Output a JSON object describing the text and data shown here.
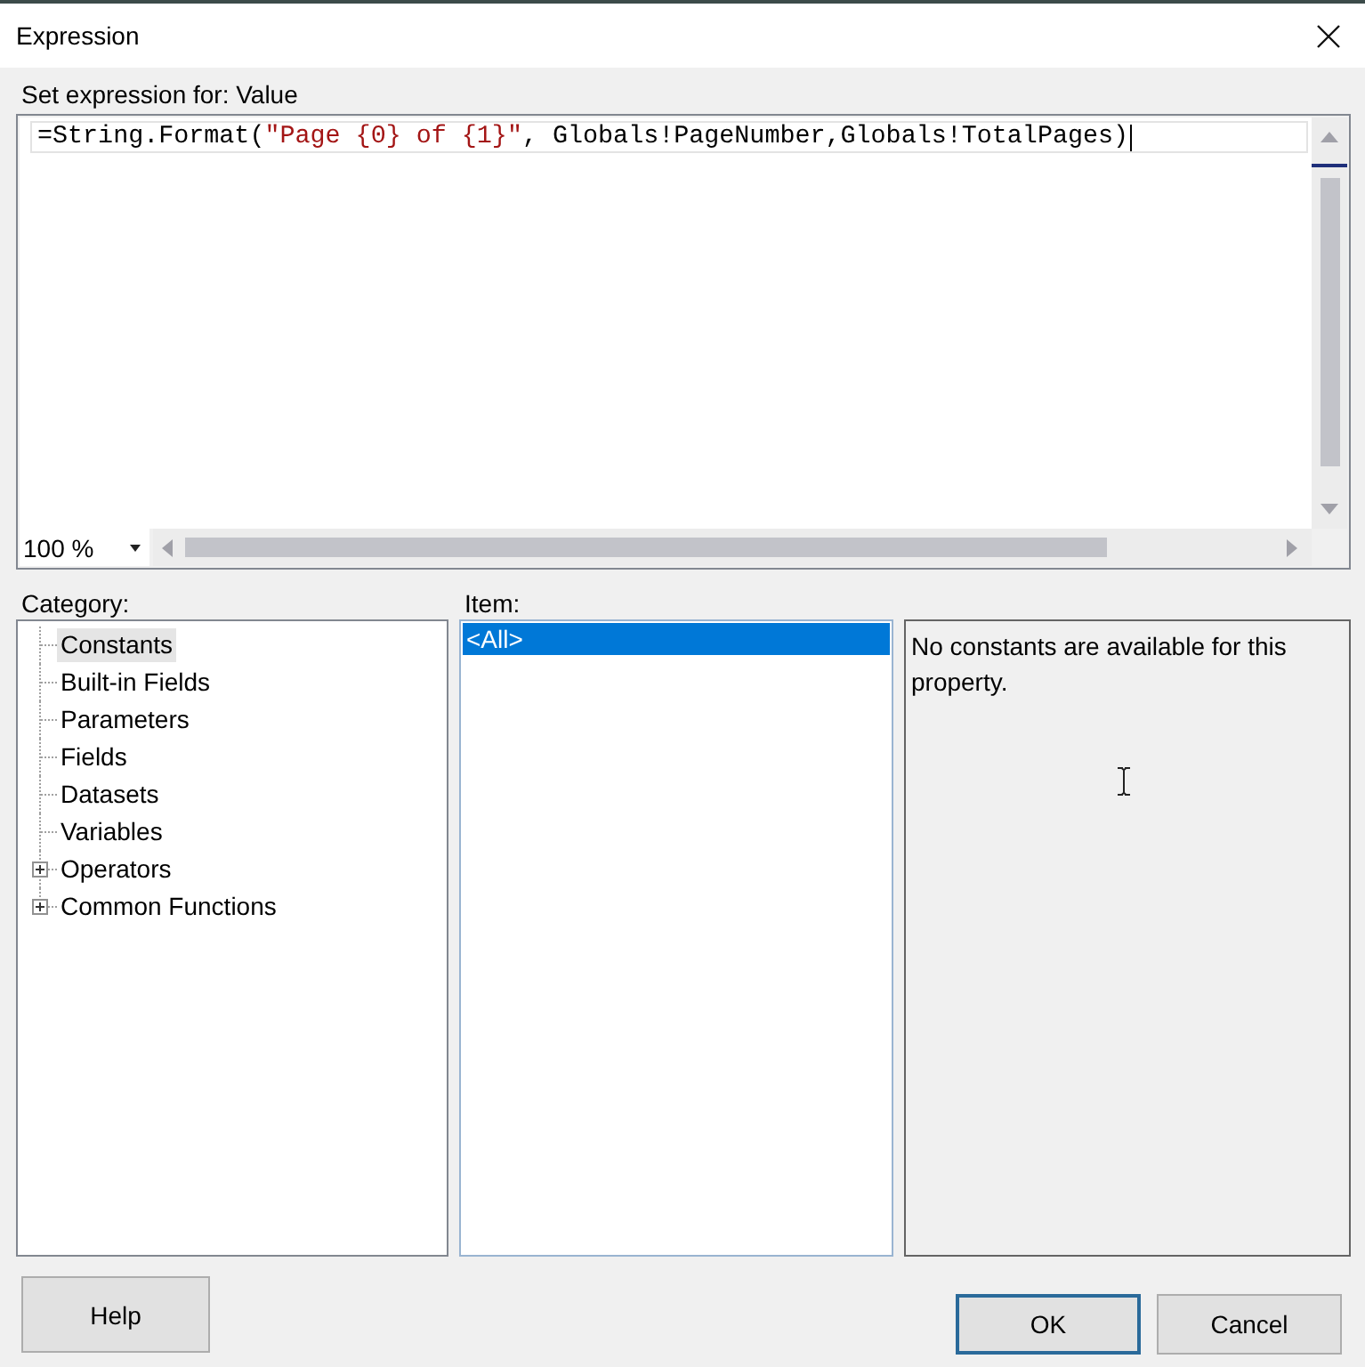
{
  "window": {
    "title": "Expression"
  },
  "expression_editor": {
    "label": "Set expression for: Value",
    "code": [
      {
        "kind": "plain",
        "text": "=String.Format("
      },
      {
        "kind": "string",
        "text": "\"Page {0} of {1}\""
      },
      {
        "kind": "plain",
        "text": ", Globals!PageNumber,Globals!TotalPages)"
      }
    ],
    "zoom": "100 %"
  },
  "category": {
    "label": "Category:",
    "tree": [
      {
        "label": "Constants",
        "kind": "leaf",
        "selected": true
      },
      {
        "label": "Built-in Fields",
        "kind": "leaf",
        "selected": false
      },
      {
        "label": "Parameters",
        "kind": "leaf",
        "selected": false
      },
      {
        "label": "Fields",
        "kind": "leaf",
        "selected": false
      },
      {
        "label": "Datasets",
        "kind": "leaf",
        "selected": false
      },
      {
        "label": "Variables",
        "kind": "leaf",
        "selected": false
      },
      {
        "label": "Operators",
        "kind": "group",
        "selected": false,
        "expanded": false
      },
      {
        "label": "Common Functions",
        "kind": "group",
        "selected": false,
        "expanded": false
      }
    ]
  },
  "item": {
    "label": "Item:",
    "items": [
      {
        "label": "<All>",
        "selected": true
      }
    ]
  },
  "description": {
    "text": "No constants are available for this property."
  },
  "buttons": [
    {
      "label": "Help",
      "kind": "help"
    },
    {
      "label": "OK",
      "kind": "default"
    },
    {
      "label": "Cancel",
      "kind": "normal"
    }
  ]
}
